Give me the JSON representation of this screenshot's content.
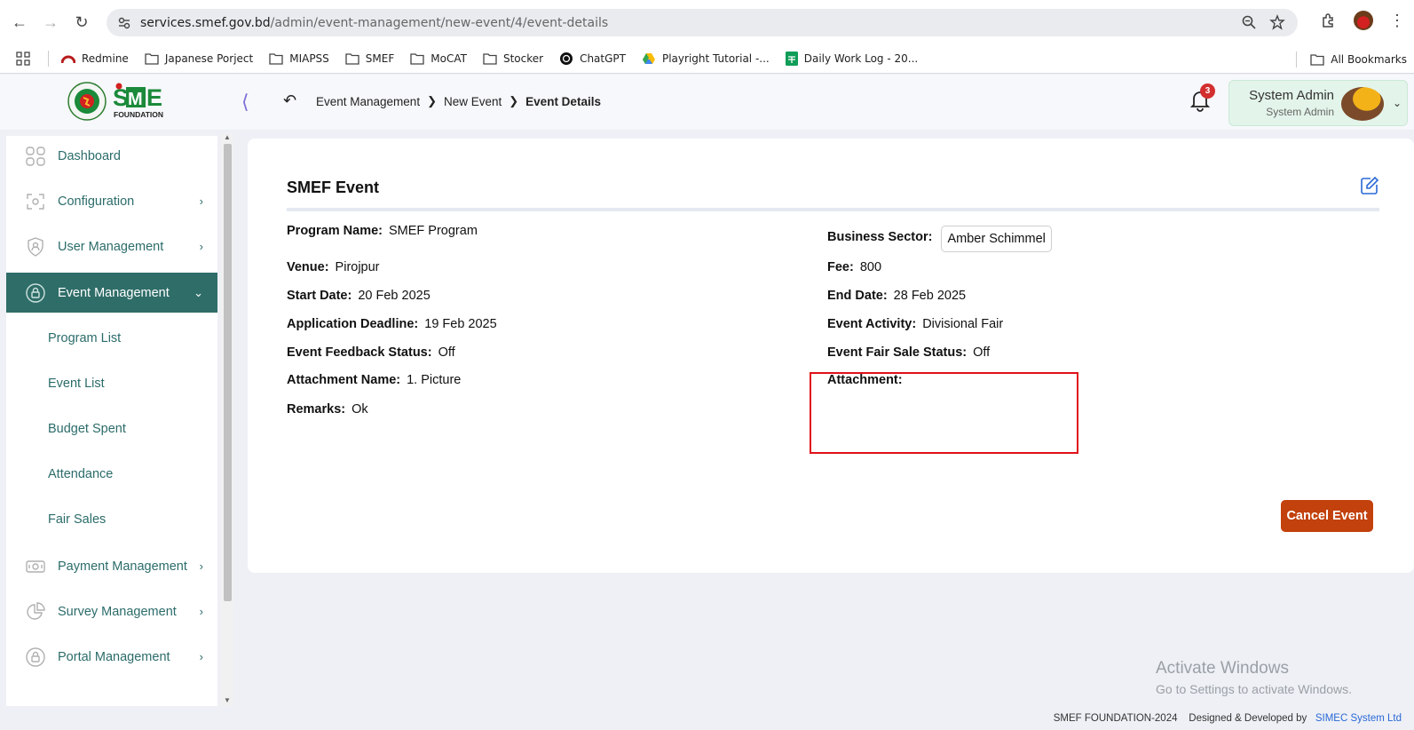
{
  "browser": {
    "url_host": "services.smef.gov.bd",
    "url_path": "/admin/event-management/new-event/4/event-details",
    "bookmarks": [
      {
        "label": "Redmine",
        "icon": "redmine-icon"
      },
      {
        "label": "Japanese Porject",
        "icon": "folder-icon"
      },
      {
        "label": "MIAPSS",
        "icon": "folder-icon"
      },
      {
        "label": "SMEF",
        "icon": "folder-icon"
      },
      {
        "label": "MoCAT",
        "icon": "folder-icon"
      },
      {
        "label": "Stocker",
        "icon": "folder-icon"
      },
      {
        "label": "ChatGPT",
        "icon": "chatgpt-icon"
      },
      {
        "label": "Playright Tutorial -...",
        "icon": "drive-icon"
      },
      {
        "label": "Daily Work Log - 20...",
        "icon": "sheets-icon"
      }
    ],
    "all_bookmarks": "All Bookmarks"
  },
  "header": {
    "breadcrumb": [
      "Event Management",
      "New Event",
      "Event Details"
    ],
    "notification_count": "3",
    "user_name": "System Admin",
    "user_role": "System Admin"
  },
  "sidebar": {
    "items": [
      {
        "label": "Dashboard",
        "icon": "dashboard-icon"
      },
      {
        "label": "Configuration",
        "icon": "configuration-icon"
      },
      {
        "label": "User Management",
        "icon": "user-shield-icon"
      },
      {
        "label": "Event Management",
        "icon": "lock-icon"
      },
      {
        "label": "Payment Management",
        "icon": "payment-icon"
      },
      {
        "label": "Survey Management",
        "icon": "pie-chart-icon"
      },
      {
        "label": "Portal Management",
        "icon": "lock-icon"
      }
    ],
    "sub_items": [
      "Program List",
      "Event List",
      "Budget Spent",
      "Attendance",
      "Fair Sales"
    ]
  },
  "event": {
    "title": "SMEF Event",
    "fields": {
      "program_name": {
        "label": "Program Name:",
        "value": "SMEF Program"
      },
      "business_sector": {
        "label": "Business Sector:",
        "value": "Amber Schimmel"
      },
      "venue": {
        "label": "Venue:",
        "value": "Pirojpur"
      },
      "fee": {
        "label": "Fee:",
        "value": "800"
      },
      "start_date": {
        "label": "Start Date:",
        "value": "20 Feb 2025"
      },
      "end_date": {
        "label": "End Date:",
        "value": "28 Feb 2025"
      },
      "application_deadline": {
        "label": "Application Deadline:",
        "value": "19 Feb 2025"
      },
      "event_activity": {
        "label": "Event Activity:",
        "value": "Divisional Fair"
      },
      "feedback_status": {
        "label": "Event Feedback Status:",
        "value": "Off"
      },
      "fair_sale_status": {
        "label": "Event Fair Sale Status:",
        "value": "Off"
      },
      "attachment_name": {
        "label": "Attachment Name:",
        "value": "1. Picture"
      },
      "attachment": {
        "label": "Attachment:",
        "value": ""
      },
      "remarks": {
        "label": "Remarks:",
        "value": "Ok"
      }
    },
    "cancel_label": "Cancel Event"
  },
  "watermark": {
    "line1": "Activate Windows",
    "line2": "Go to Settings to activate Windows."
  },
  "footer": {
    "copyright": "SMEF FOUNDATION-2024",
    "designed": "Designed & Developed by",
    "company": "SIMEC System Ltd"
  },
  "colors": {
    "accent": "#2f6d68",
    "cancel": "#c2410c",
    "highlight": "#e0101b",
    "badge": "#d32f2f"
  }
}
